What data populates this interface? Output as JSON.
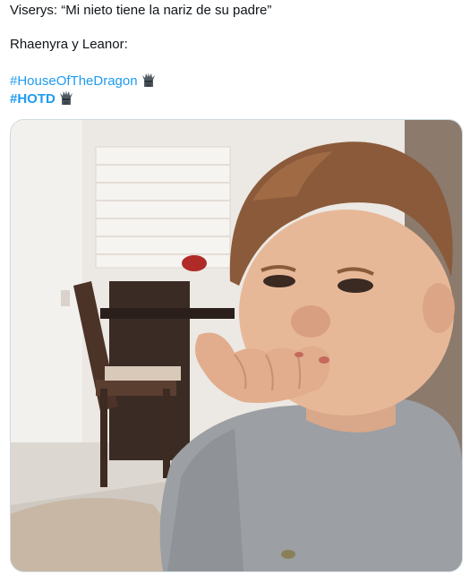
{
  "tweet": {
    "line1": "Viserys: “Mi nieto tiene la nariz de su padre”",
    "line2": "Rhaenyra y Leanor:",
    "hashtag1": "#HouseOfTheDragon",
    "hashtag2": "#HOTD",
    "emoji_icon": "iron-throne-icon"
  },
  "media": {
    "alt": "Photo of a toddler in a grey t-shirt covering his mouth with his hand",
    "colors": {
      "shirt": "#9c9fa3",
      "skin": "#e7b898",
      "hair": "#8a5a3a",
      "wall": "#ece8e3"
    }
  }
}
